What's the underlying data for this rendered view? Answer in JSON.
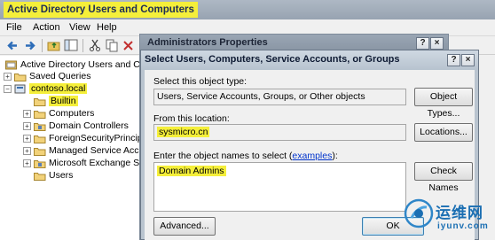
{
  "app": {
    "title": "Active Directory Users and Computers"
  },
  "menu": [
    "File",
    "Action",
    "View",
    "Help"
  ],
  "tree": {
    "root": "Active Directory Users and Con",
    "saved_queries": "Saved Queries",
    "domain": "contoso.local",
    "children": [
      "Builtin",
      "Computers",
      "Domain Controllers",
      "ForeignSecurityPrincipal",
      "Managed Service Acco",
      "Microsoft Exchange Sec",
      "Users"
    ]
  },
  "props_dialog": {
    "title": "Administrators Properties",
    "help": "?",
    "close": "×"
  },
  "select_dialog": {
    "title": "Select Users, Computers, Service Accounts, or Groups",
    "help": "?",
    "close": "×",
    "object_type_label": "Select this object type:",
    "object_type_value": "Users, Service Accounts, Groups, or Other objects",
    "object_types_button": "Object Types...",
    "location_label": "From this location:",
    "location_value": "sysmicro.cn",
    "locations_button": "Locations...",
    "names_label_prefix": "Enter the object names to select (",
    "names_label_link": "examples",
    "names_label_suffix": "):",
    "names_value": "Domain Admins",
    "check_names_button": "Check Names",
    "advanced_button": "Advanced...",
    "ok_button": "OK"
  },
  "watermark": {
    "cn": "运维网",
    "en": "iyunv.com"
  },
  "colors": {
    "highlight": "#f5ef3a",
    "link": "#0033cc"
  }
}
